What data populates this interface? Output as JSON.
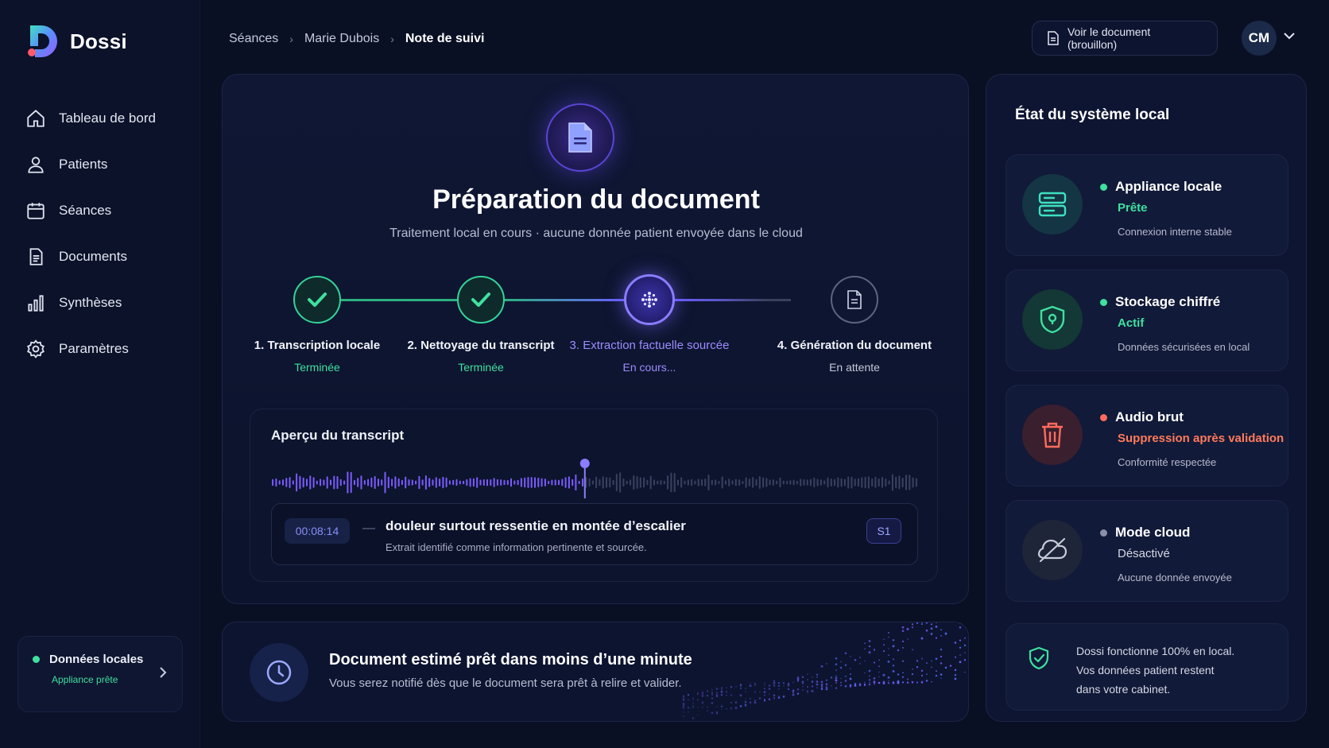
{
  "app": {
    "name": "Dossi"
  },
  "sidebar": {
    "items": [
      {
        "label": "Tableau de bord",
        "icon": "home-icon"
      },
      {
        "label": "Patients",
        "icon": "user-icon"
      },
      {
        "label": "Séances",
        "icon": "calendar-icon"
      },
      {
        "label": "Documents",
        "icon": "document-icon"
      },
      {
        "label": "Synthèses",
        "icon": "bar-chart-icon"
      },
      {
        "label": "Paramètres",
        "icon": "gear-icon"
      }
    ],
    "local_card": {
      "title": "Données locales",
      "subtitle": "Appliance prête"
    }
  },
  "header": {
    "breadcrumb": [
      "Séances",
      "Marie Dubois",
      "Note de suivi"
    ],
    "doc_button": "Voir le document (brouillon)",
    "user_initials": "CM"
  },
  "main": {
    "title": "Préparation du document",
    "subtitle": "Traitement local en cours · aucune donnée patient envoyée dans le cloud",
    "steps": [
      {
        "label": "1. Transcription locale",
        "status": "Terminée",
        "state": "done"
      },
      {
        "label": "2. Nettoyage du transcript",
        "status": "Terminée",
        "state": "done"
      },
      {
        "label": "3. Extraction factuelle sourcée",
        "status": "En cours...",
        "state": "active"
      },
      {
        "label": "4. Génération du document",
        "status": "En attente",
        "state": "pending"
      }
    ],
    "transcript": {
      "title": "Aperçu du transcript",
      "playback_progress": 0.485,
      "segment": {
        "timestamp": "00:08:14",
        "separator": "—",
        "text": "douleur surtout ressentie en montée d’escalier",
        "note": "Extrait identifié comme information pertinente et sourcée.",
        "speaker": "S1"
      }
    },
    "eta": {
      "title": "Document estimé prêt dans moins d’une minute",
      "subtitle": "Vous serez notifié dès que le document sera prêt à relire et valider."
    }
  },
  "system": {
    "title": "État du système local",
    "items": [
      {
        "name": "Appliance locale",
        "status": "Prête",
        "detail": "Connexion interne stable",
        "status_color": "#3fe0a0",
        "dot_color": "#3fe0a0",
        "icon": "server-icon"
      },
      {
        "name": "Stockage chiffré",
        "status": "Actif",
        "detail": "Données sécurisées en local",
        "status_color": "#3fe0a0",
        "dot_color": "#3fe0a0",
        "icon": "shield-lock-icon"
      },
      {
        "name": "Audio brut",
        "status": "Suppression après validation",
        "detail": "Conformité respectée",
        "status_color": "#ff7a5c",
        "dot_color": "#ff6b5c",
        "icon": "trash-icon"
      },
      {
        "name": "Mode cloud",
        "status": "Désactivé",
        "detail": "Aucune donnée envoyée",
        "status_color": "#d4d8e6",
        "dot_color": "#8a90a8",
        "icon": "cloud-off-icon"
      }
    ],
    "info": [
      "Dossi fonctionne 100% en local.",
      "Vos données patient restent",
      "dans votre cabinet."
    ]
  },
  "colors": {
    "accent": "#7c5cff",
    "success": "#3fe0a0",
    "danger": "#ff6b5c",
    "background": "#0a1024"
  }
}
